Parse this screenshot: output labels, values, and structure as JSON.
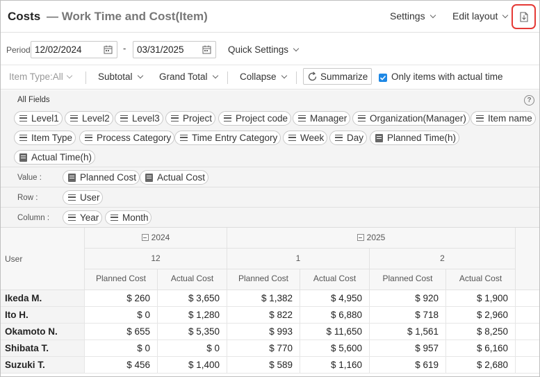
{
  "header": {
    "title": "Costs",
    "subtitle": "— Work Time and Cost(Item)",
    "settings_label": "Settings",
    "edit_layout_label": "Edit layout",
    "export_icon": "file-download-icon"
  },
  "period": {
    "label": "Period",
    "start": "12/02/2024",
    "end": "03/31/2025",
    "separator": "-",
    "quick_settings_label": "Quick Settings"
  },
  "toolbar": {
    "item_type_label": "Item Type:All",
    "subtotal_label": "Subtotal",
    "grand_total_label": "Grand Total",
    "collapse_label": "Collapse",
    "summarize_label": "Summarize",
    "only_actual_label": "Only items with actual time",
    "only_actual_checked": true
  },
  "fields": {
    "all_fields_label": "All Fields",
    "help": "?",
    "all": [
      {
        "label": "Level1",
        "icon": "list-icon"
      },
      {
        "label": "Level2",
        "icon": "list-icon"
      },
      {
        "label": "Level3",
        "icon": "list-icon"
      },
      {
        "label": "Project",
        "icon": "list-icon"
      },
      {
        "label": "Project code",
        "icon": "list-icon"
      },
      {
        "label": "Manager",
        "icon": "list-icon"
      },
      {
        "label": "Organization(Manager)",
        "icon": "list-icon"
      },
      {
        "label": "Item name",
        "icon": "list-icon"
      },
      {
        "label": "Item Type",
        "icon": "list-icon"
      },
      {
        "label": "Process Category",
        "icon": "list-icon"
      },
      {
        "label": "Time Entry Category",
        "icon": "list-icon"
      },
      {
        "label": "Week",
        "icon": "list-icon"
      },
      {
        "label": "Day",
        "icon": "list-icon"
      },
      {
        "label": "Planned Time(h)",
        "icon": "numeric-field-icon"
      },
      {
        "label": "Actual Time(h)",
        "icon": "numeric-field-icon"
      }
    ],
    "value_label": "Value :",
    "values": [
      {
        "label": "Planned Cost",
        "icon": "numeric-field-icon"
      },
      {
        "label": "Actual Cost",
        "icon": "numeric-field-icon"
      }
    ],
    "row_label": "Row :",
    "rows": [
      {
        "label": "User",
        "icon": "list-icon"
      }
    ],
    "column_label": "Column :",
    "columns": [
      {
        "label": "Year",
        "icon": "list-icon"
      },
      {
        "label": "Month",
        "icon": "list-icon"
      }
    ]
  },
  "table": {
    "row_header": "User",
    "years": [
      "2024",
      "2025"
    ],
    "months": [
      "12",
      "1",
      "2"
    ],
    "measures": [
      "Planned Cost",
      "Actual Cost",
      "Planned Cost",
      "Actual Cost",
      "Planned Cost",
      "Actual Cost"
    ],
    "rows": [
      {
        "user": "Ikeda M.",
        "cells": [
          "$ 260",
          "$ 3,650",
          "$ 1,382",
          "$ 4,950",
          "$ 920",
          "$ 1,900"
        ]
      },
      {
        "user": "Ito H.",
        "cells": [
          "$ 0",
          "$ 1,280",
          "$ 822",
          "$ 6,880",
          "$ 718",
          "$ 2,960"
        ]
      },
      {
        "user": "Okamoto N.",
        "cells": [
          "$ 655",
          "$ 5,350",
          "$ 993",
          "$ 11,650",
          "$ 1,561",
          "$ 8,250"
        ]
      },
      {
        "user": "Shibata T.",
        "cells": [
          "$ 0",
          "$ 0",
          "$ 770",
          "$ 5,600",
          "$ 957",
          "$ 6,160"
        ]
      },
      {
        "user": "Suzuki T.",
        "cells": [
          "$ 456",
          "$ 1,400",
          "$ 589",
          "$ 1,160",
          "$ 619",
          "$ 2,680"
        ]
      }
    ]
  },
  "colors": {
    "accent": "#1e88e5",
    "highlight": "#e53935"
  }
}
